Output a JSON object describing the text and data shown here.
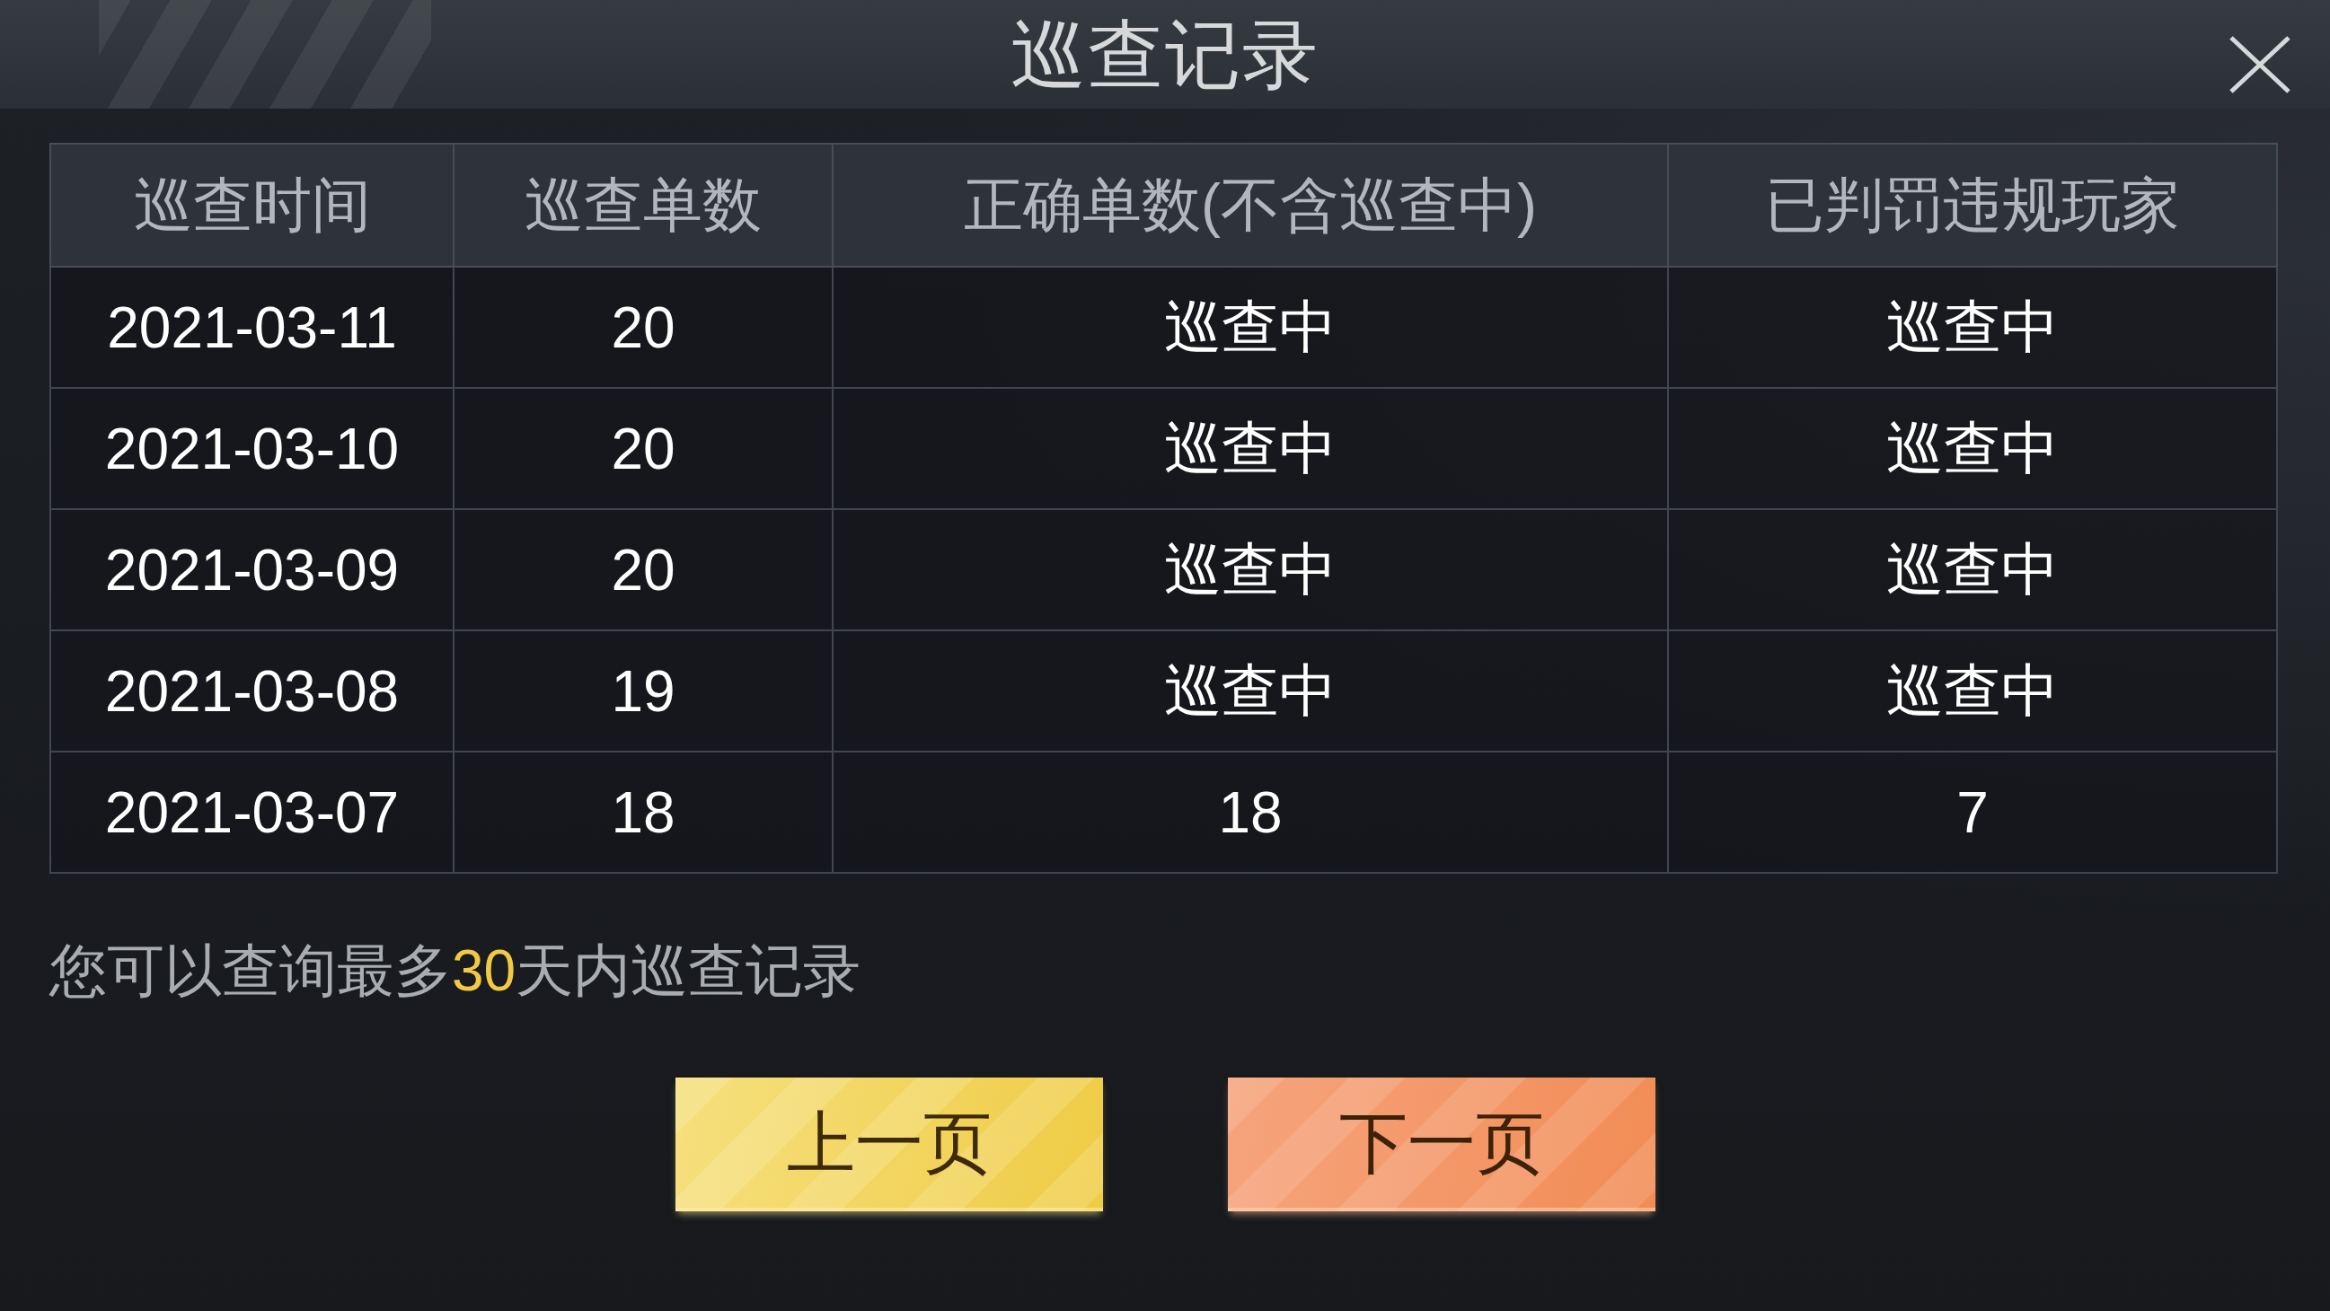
{
  "window": {
    "title": "巡查记录"
  },
  "table": {
    "columns": [
      "巡查时间",
      "巡查单数",
      "正确单数(不含巡查中)",
      "已判罚违规玩家"
    ],
    "rows": [
      [
        "2021-03-11",
        "20",
        "巡查中",
        "巡查中"
      ],
      [
        "2021-03-10",
        "20",
        "巡查中",
        "巡查中"
      ],
      [
        "2021-03-09",
        "20",
        "巡查中",
        "巡查中"
      ],
      [
        "2021-03-08",
        "19",
        "巡查中",
        "巡查中"
      ],
      [
        "2021-03-07",
        "18",
        "18",
        "7"
      ]
    ]
  },
  "note": {
    "before": "您可以查询最多",
    "highlight": "30",
    "after": "天内巡查记录"
  },
  "buttons": [
    {
      "label": "上一页",
      "kind": "gold"
    },
    {
      "label": "下一页",
      "kind": "coral"
    }
  ]
}
